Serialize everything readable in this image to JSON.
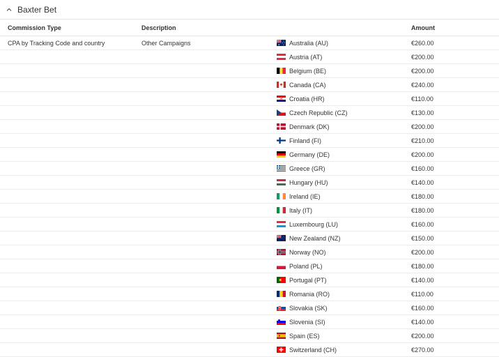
{
  "panel": {
    "title": "Baxter Bet"
  },
  "table": {
    "headers": {
      "commission_type": "Commission Type",
      "description": "Description",
      "amount": "Amount"
    },
    "group": {
      "commission_type": "CPA by Tracking Code and country",
      "description": "Other Campaigns"
    },
    "rows": [
      {
        "country": "Australia (AU)",
        "flag": "AU",
        "amount": "€260.00"
      },
      {
        "country": "Austria (AT)",
        "flag": "AT",
        "amount": "€200.00"
      },
      {
        "country": "Belgium (BE)",
        "flag": "BE",
        "amount": "€200.00"
      },
      {
        "country": "Canada (CA)",
        "flag": "CA",
        "amount": "€240.00"
      },
      {
        "country": "Croatia (HR)",
        "flag": "HR",
        "amount": "€110.00"
      },
      {
        "country": "Czech Republic (CZ)",
        "flag": "CZ",
        "amount": "€130.00"
      },
      {
        "country": "Denmark (DK)",
        "flag": "DK",
        "amount": "€200.00"
      },
      {
        "country": "Finland (FI)",
        "flag": "FI",
        "amount": "€210.00"
      },
      {
        "country": "Germany (DE)",
        "flag": "DE",
        "amount": "€200.00"
      },
      {
        "country": "Greece (GR)",
        "flag": "GR",
        "amount": "€160.00"
      },
      {
        "country": "Hungary (HU)",
        "flag": "HU",
        "amount": "€140.00"
      },
      {
        "country": "Ireland (IE)",
        "flag": "IE",
        "amount": "€180.00"
      },
      {
        "country": "Italy (IT)",
        "flag": "IT",
        "amount": "€180.00"
      },
      {
        "country": "Luxembourg (LU)",
        "flag": "LU",
        "amount": "€160.00"
      },
      {
        "country": "New Zealand (NZ)",
        "flag": "NZ",
        "amount": "€150.00"
      },
      {
        "country": "Norway (NO)",
        "flag": "NO",
        "amount": "€200.00"
      },
      {
        "country": "Poland (PL)",
        "flag": "PL",
        "amount": "€180.00"
      },
      {
        "country": "Portugal (PT)",
        "flag": "PT",
        "amount": "€140.00"
      },
      {
        "country": "Romania (RO)",
        "flag": "RO",
        "amount": "€110.00"
      },
      {
        "country": "Slovakia (SK)",
        "flag": "SK",
        "amount": "€160.00"
      },
      {
        "country": "Slovenia (SI)",
        "flag": "SI",
        "amount": "€140.00"
      },
      {
        "country": "Spain (ES)",
        "flag": "ES",
        "amount": "€200.00"
      },
      {
        "country": "Switzerland (CH)",
        "flag": "CH",
        "amount": "€270.00"
      }
    ]
  }
}
